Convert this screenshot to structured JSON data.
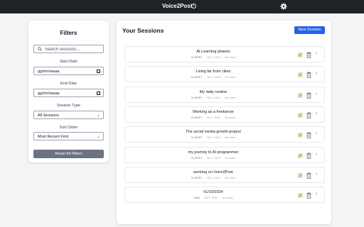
{
  "header": {
    "title": "Voice2Post"
  },
  "filters": {
    "title": "Filters",
    "search_placeholder": "Search sessions...",
    "start_date_label": "Start Date",
    "start_date_value": "gg/mm/aaaa",
    "end_date_label": "End Date",
    "end_date_value": "gg/mm/aaaa",
    "session_type_label": "Session Type",
    "session_type_value": "All Sessions",
    "sort_order_label": "Sort Order",
    "sort_order_value": "Most Recent First",
    "reset_label": "Reset All Filters"
  },
  "main": {
    "title": "Your Sessions",
    "new_session_label": "New Session",
    "sessions": [
      {
        "title": "AI Learning phases",
        "user": "CLARIFY",
        "date": "Oct 1, 2024",
        "notes": "No notes"
      },
      {
        "title": "Living far from cities",
        "user": "CLARIFY",
        "date": "Oct 1, 2024",
        "notes": "No notes"
      },
      {
        "title": "My daily routine",
        "user": "CLARIFY",
        "date": "Oct 1, 2024",
        "notes": "No notes"
      },
      {
        "title": "Working as a freelancer",
        "user": "CLARIFY",
        "date": "Oct 1, 2024",
        "notes": "No notes"
      },
      {
        "title": "The social media growth project",
        "user": "CLARIFY",
        "date": "Oct 1, 2024",
        "notes": "No notes"
      },
      {
        "title": "my journey to AI programmer",
        "user": "CLARIFY",
        "date": "Oct 1, 2024",
        "notes": "No notes"
      },
      {
        "title": "working on Voice2Post",
        "user": "CLARIFY",
        "date": "Oct 1, 2024",
        "notes": "No notes"
      },
      {
        "title": "01/10/2024",
        "user": "Daily",
        "date": "Oct 1, 2024",
        "notes": "No notes"
      }
    ]
  },
  "colors": {
    "header_bg": "#1f2328",
    "primary": "#2563eb",
    "reset_bg": "#6b7280"
  }
}
